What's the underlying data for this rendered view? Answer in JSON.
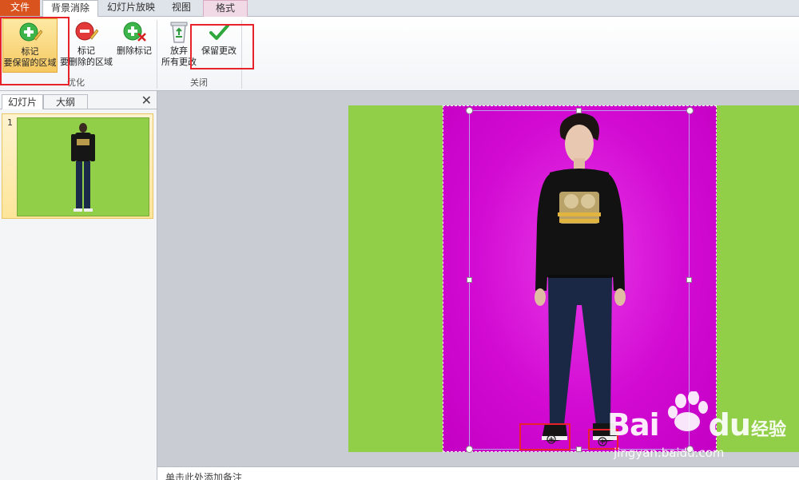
{
  "tabs": {
    "file": "文件",
    "background_removal": "背景消除",
    "slideshow": "幻灯片放映",
    "view": "视图",
    "format": "格式"
  },
  "ribbon": {
    "mark_keep_line1": "标记",
    "mark_keep_line2": "要保留的区域",
    "mark_remove_line1": "标记",
    "mark_remove_line2": "要删除的区域",
    "delete_mark": "删除标记",
    "discard_line1": "放弃",
    "discard_line2": "所有更改",
    "keep_changes": "保留更改",
    "group_refine": "优化",
    "group_close": "关闭"
  },
  "left_pane": {
    "tab_slides": "幻灯片",
    "tab_outline": "大纲",
    "close_glyph": "✕",
    "slide_number": "1"
  },
  "notes": {
    "placeholder": "单击此处添加备注"
  },
  "watermark": {
    "brand": "Bai",
    "brand2": "du",
    "suffix": "经验",
    "url": "jingyan.baidu.com"
  },
  "colors": {
    "slide_green": "#92cf48",
    "keep_magenta": "#d20ad2",
    "highlight_red": "#e8222a",
    "file_tab": "#d9531e"
  }
}
